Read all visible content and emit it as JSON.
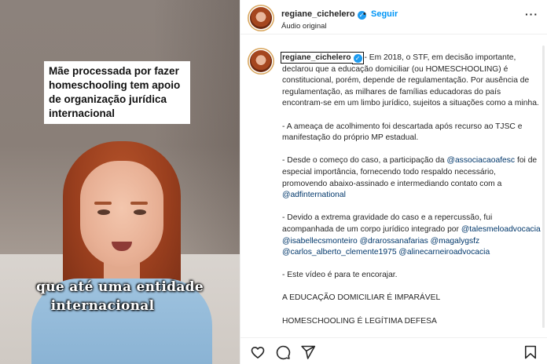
{
  "video": {
    "headline": "Mãe processada por fazer homeschooling tem apoio de organização jurídica internacional",
    "caption_line1": "que até uma entidade",
    "caption_line2": "internacional"
  },
  "header": {
    "username": "regiane_cichelero",
    "separator": "•",
    "follow_label": "Seguir",
    "audio_label": "Áudio original",
    "more_icon": "more-horizontal-icon"
  },
  "post": {
    "username": "regiane_cichelero",
    "p1_rest": "- Em 2018, o STF, em decisão importante, declarou que a educação domiciliar (ou HOMESCHOOLING) é constitucional, porém, depende de regulamentação. Por ausência de regulamentação, as milhares de famílias educadoras do país encontram-se em um limbo jurídico, sujeitos a situações como a minha.",
    "p2": "- A ameaça de acolhimento foi descartada após recurso ao TJSC e manifestação do próprio MP estadual.",
    "p3_a": "- Desde o começo do caso, a participação da ",
    "p3_link1": "@associacaoafesc",
    "p3_b": " foi de especial importância, fornecendo todo respaldo necessário, promovendo abaixo-assinado e intermediando contato com a ",
    "p3_link2": "@adfinternational",
    "p4_a": "- Devido a extrema gravidade do caso e a repercussão, fui acompanhada de um corpo jurídico integrado por ",
    "p4_links": [
      "@talesmeloadvocacia",
      "@isabellecsmonteiro",
      "@drarossanafarias",
      "@magalygsfz",
      "@carlos_alberto_clemente1975",
      "@alinecarneiroadvocacia"
    ],
    "p5": "- Este vídeo é para te encorajar.",
    "p6": "A EDUCAÇÃO DOMICILIAR É IMPARÁVEL",
    "p7": "HOMESCHOOLING É LEGÍTIMA DEFESA"
  },
  "actions": {
    "icons": [
      "heart-icon",
      "comment-icon",
      "share-icon",
      "bookmark-icon"
    ]
  },
  "colors": {
    "link": "#00376b",
    "follow": "#0095f6",
    "verified": "#1d9bf0"
  }
}
